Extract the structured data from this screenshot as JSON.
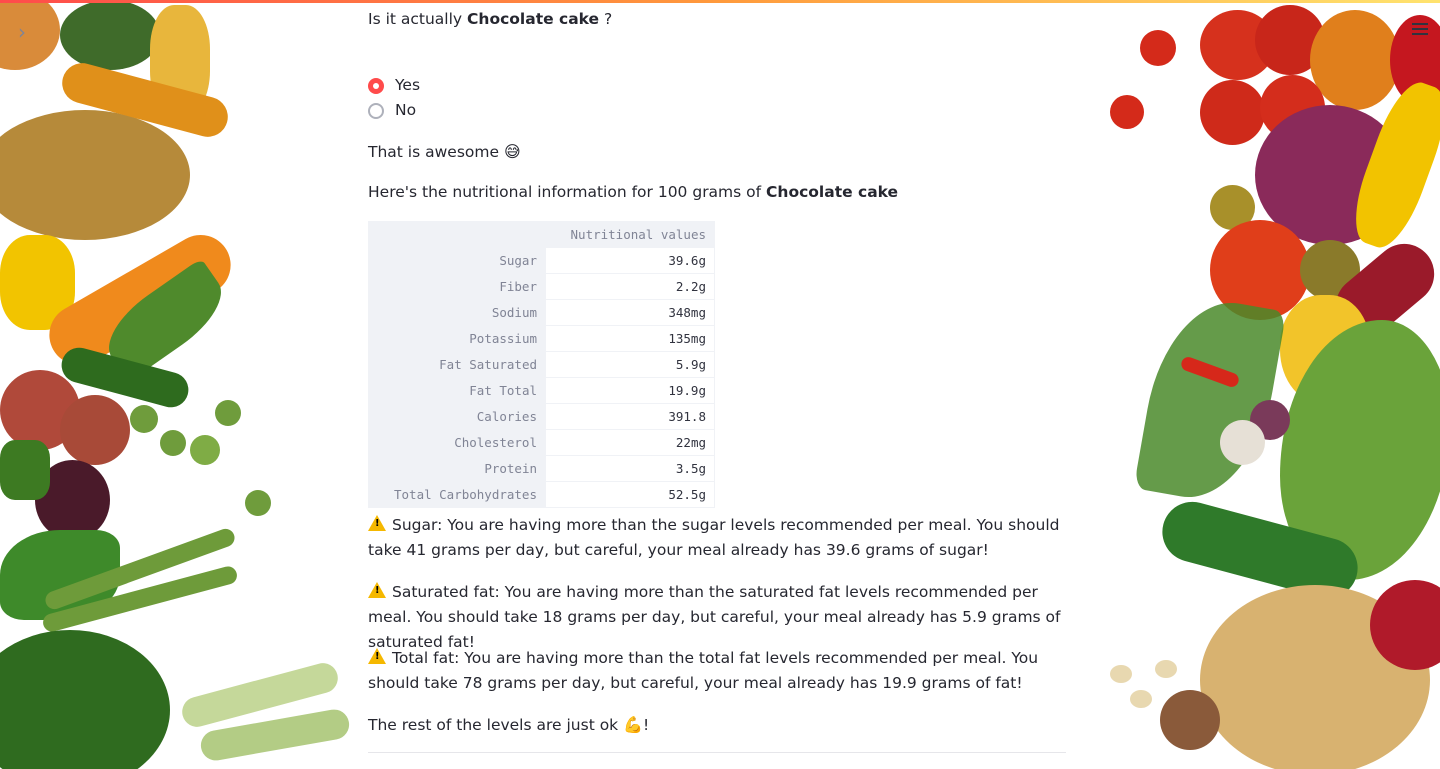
{
  "question": {
    "prefix": "Is it actually ",
    "food": "Chocolate cake",
    "suffix": " ?"
  },
  "radio_options": [
    {
      "label": "Yes",
      "selected": true
    },
    {
      "label": "No",
      "selected": false
    }
  ],
  "response": {
    "text": "That is awesome ",
    "emoji": "😅"
  },
  "nutrition_intro": {
    "prefix": "Here's the nutritional information for 100 grams of ",
    "food": "Chocolate cake"
  },
  "table": {
    "header": "Nutritional values",
    "rows": [
      {
        "name": "Sugar",
        "value": "39.6g"
      },
      {
        "name": "Fiber",
        "value": "2.2g"
      },
      {
        "name": "Sodium",
        "value": "348mg"
      },
      {
        "name": "Potassium",
        "value": "135mg"
      },
      {
        "name": "Fat Saturated",
        "value": "5.9g"
      },
      {
        "name": "Fat Total",
        "value": "19.9g"
      },
      {
        "name": "Calories",
        "value": "391.8"
      },
      {
        "name": "Cholesterol",
        "value": "22mg"
      },
      {
        "name": "Protein",
        "value": "3.5g"
      },
      {
        "name": "Total Carbohydrates",
        "value": "52.5g"
      }
    ]
  },
  "warnings": [
    {
      "text": "Sugar: You are having more than the sugar levels recommended per meal. You should take 41 grams per day, but careful, your meal already has 39.6 grams of sugar!"
    },
    {
      "text": "Saturated fat: You are having more than the saturated fat levels recommended per meal. You should take 18 grams per day, but careful, your meal already has 5.9 grams of saturated fat!"
    },
    {
      "text": "Total fat: You are having more than the total fat levels recommended per meal. You should take 78 grams per day, but careful, your meal already has 19.9 grams of fat!"
    }
  ],
  "closing": {
    "text": "The rest of the levels are just ok ",
    "emoji": "💪",
    "suffix": "!"
  },
  "icons": {
    "collapse": "chevron-right-icon",
    "menu": "hamburger-menu-icon",
    "warning": "warning-icon"
  },
  "colors": {
    "accent": "#ff4b4b",
    "text": "#262730",
    "table_header_bg": "#f0f2f6"
  }
}
